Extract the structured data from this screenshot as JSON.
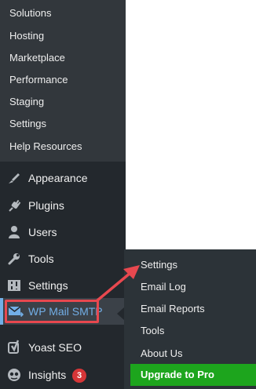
{
  "submenu": {
    "items": [
      {
        "label": "Solutions"
      },
      {
        "label": "Hosting"
      },
      {
        "label": "Marketplace"
      },
      {
        "label": "Performance"
      },
      {
        "label": "Staging"
      },
      {
        "label": "Settings"
      },
      {
        "label": "Help Resources"
      }
    ]
  },
  "menu": {
    "items": [
      {
        "label": "Appearance",
        "icon": "paintbrush-icon"
      },
      {
        "label": "Plugins",
        "icon": "plug-icon"
      },
      {
        "label": "Users",
        "icon": "user-icon"
      },
      {
        "label": "Tools",
        "icon": "wrench-icon"
      },
      {
        "label": "Settings",
        "icon": "sliders-icon"
      },
      {
        "label": "WP Mail SMTP",
        "icon": "mail-icon"
      },
      {
        "label": "Yoast SEO",
        "icon": "yoast-icon"
      },
      {
        "label": "Insights",
        "icon": "insights-icon",
        "badge": "3"
      }
    ]
  },
  "flyout": {
    "items": [
      {
        "label": "Settings"
      },
      {
        "label": "Email Log"
      },
      {
        "label": "Email Reports"
      },
      {
        "label": "Tools"
      },
      {
        "label": "About Us"
      }
    ],
    "upgrade_label": "Upgrade to Pro"
  },
  "colors": {
    "sidebar": "#23282d",
    "submenu": "#32373c",
    "active_text": "#72aee6",
    "highlight": "#e8484f",
    "upgrade": "#1da51d",
    "badge": "#d63638"
  }
}
